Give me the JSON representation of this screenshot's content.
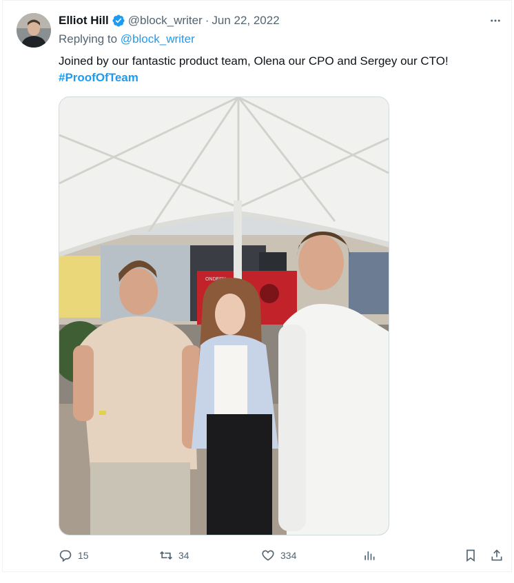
{
  "tweet": {
    "display_name": "Elliot Hill",
    "verified_icon": "verified-badge-icon",
    "handle": "@block_writer",
    "separator": "·",
    "date": "Jun 22, 2022",
    "replying_prefix": "Replying to",
    "replying_to": "@block_writer",
    "text": "Joined by our fantastic product team, Olena our CPO and Sergey our CTO!",
    "hashtag": "#ProofOfTeam",
    "more_icon": "more-horizontal-icon"
  },
  "photo": {
    "sign_text": "ONDERY"
  },
  "actions": {
    "reply_count": "15",
    "retweet_count": "34",
    "like_count": "334",
    "reply_icon": "reply-icon",
    "retweet_icon": "retweet-icon",
    "like_icon": "heart-icon",
    "views_icon": "views-icon",
    "bookmark_icon": "bookmark-icon",
    "share_icon": "share-icon"
  },
  "colors": {
    "accent": "#1d9bf0",
    "secondary_text": "#536471",
    "primary_text": "#0f1419"
  }
}
